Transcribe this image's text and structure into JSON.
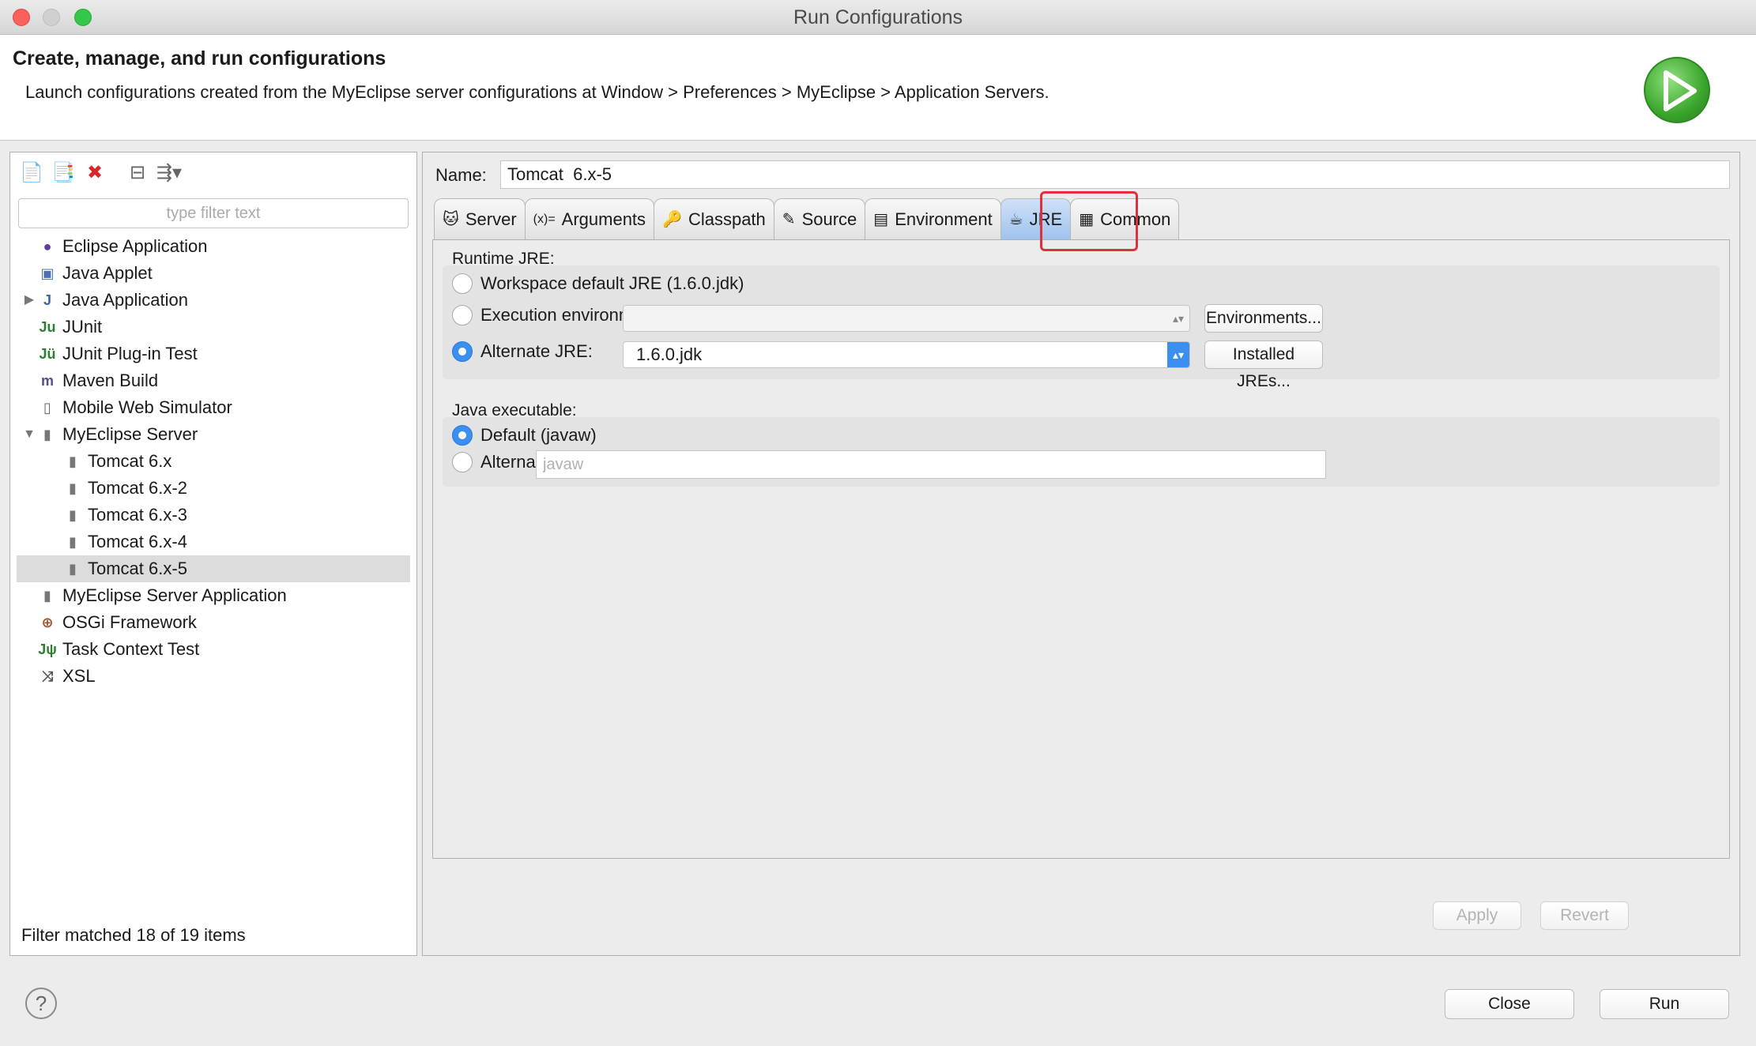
{
  "window": {
    "title": "Run Configurations"
  },
  "banner": {
    "title": "Create, manage, and run configurations",
    "description": "Launch configurations created from the MyEclipse server configurations at Window > Preferences > MyEclipse > Application Servers.",
    "icon": "run-icon"
  },
  "left": {
    "toolbar": [
      {
        "name": "new-config-icon",
        "glyph": "📄"
      },
      {
        "name": "duplicate-config-icon",
        "glyph": "📑"
      },
      {
        "name": "delete-config-icon",
        "glyph": "✖"
      },
      {
        "name": "collapse-all-icon",
        "glyph": "⊟"
      },
      {
        "name": "filter-menu-icon",
        "glyph": "⇶▾"
      }
    ],
    "filter_placeholder": "type filter text",
    "tree": [
      {
        "label": "Eclipse Application",
        "icon": "eclipse-icon",
        "glyph": "●",
        "color": "#5a3d9e",
        "level": 0
      },
      {
        "label": "Java Applet",
        "icon": "applet-icon",
        "glyph": "▣",
        "color": "#4a6fb5",
        "level": 0
      },
      {
        "label": "Java Application",
        "icon": "java-app-icon",
        "glyph": "J",
        "color": "#3b63a8",
        "level": 0,
        "expander": "▶"
      },
      {
        "label": "JUnit",
        "icon": "junit-icon",
        "glyph": "Ju",
        "color": "#2f7d32",
        "level": 0
      },
      {
        "label": "JUnit Plug-in Test",
        "icon": "junit-plugin-icon",
        "glyph": "Jü",
        "color": "#2f7d32",
        "level": 0
      },
      {
        "label": "Maven Build",
        "icon": "maven-icon",
        "glyph": "m",
        "color": "#5a4a8e",
        "level": 0
      },
      {
        "label": "Mobile Web Simulator",
        "icon": "mobile-sim-icon",
        "glyph": "▯",
        "color": "#666666",
        "level": 0
      },
      {
        "label": "MyEclipse Server",
        "icon": "server-icon",
        "glyph": "▮",
        "color": "#777777",
        "level": 0,
        "expander": "▼"
      },
      {
        "label": "Tomcat  6.x",
        "icon": "server-config-icon",
        "glyph": "▮",
        "color": "#777777",
        "level": 1
      },
      {
        "label": "Tomcat  6.x-2",
        "icon": "server-config-icon",
        "glyph": "▮",
        "color": "#777777",
        "level": 1
      },
      {
        "label": "Tomcat  6.x-3",
        "icon": "server-config-icon",
        "glyph": "▮",
        "color": "#777777",
        "level": 1
      },
      {
        "label": "Tomcat  6.x-4",
        "icon": "server-config-icon",
        "glyph": "▮",
        "color": "#777777",
        "level": 1
      },
      {
        "label": "Tomcat  6.x-5",
        "icon": "server-config-icon",
        "glyph": "▮",
        "color": "#777777",
        "level": 1,
        "selected": true
      },
      {
        "label": "MyEclipse Server Application",
        "icon": "server-app-icon",
        "glyph": "▮",
        "color": "#777777",
        "level": 0
      },
      {
        "label": "OSGi Framework",
        "icon": "osgi-icon",
        "glyph": "⊕",
        "color": "#a0522d",
        "level": 0
      },
      {
        "label": "Task Context Test",
        "icon": "task-test-icon",
        "glyph": "Jψ",
        "color": "#2f7d32",
        "level": 0
      },
      {
        "label": "XSL",
        "icon": "xsl-icon",
        "glyph": "⤨",
        "color": "#555555",
        "level": 0
      }
    ],
    "status": "Filter matched 18 of 19 items"
  },
  "right": {
    "name_label": "Name:",
    "name_value": "Tomcat  6.x-5",
    "tabs": [
      {
        "label": "Server",
        "icon": "server-tab-icon",
        "glyph": "🐱"
      },
      {
        "label": "Arguments",
        "icon": "arguments-tab-icon",
        "glyph": "(x)="
      },
      {
        "label": "Classpath",
        "icon": "classpath-tab-icon",
        "glyph": "🔑"
      },
      {
        "label": "Source",
        "icon": "source-tab-icon",
        "glyph": "✎"
      },
      {
        "label": "Environment",
        "icon": "environment-tab-icon",
        "glyph": "▤"
      },
      {
        "label": "JRE",
        "icon": "jre-tab-icon",
        "glyph": "☕",
        "active": true
      },
      {
        "label": "Common",
        "icon": "common-tab-icon",
        "glyph": "▦"
      }
    ],
    "runtime_jre": {
      "label": "Runtime JRE:",
      "workspace_default": "Workspace default JRE (1.6.0.jdk)",
      "execution_env": "Execution environment:",
      "environments_button": "Environments...",
      "alternate_jre": "Alternate JRE:",
      "alternate_value": "1.6.0.jdk",
      "installed_button": "Installed JREs...",
      "selected": "alternate"
    },
    "java_exec": {
      "label": "Java executable:",
      "default": "Default (javaw)",
      "alternate": "Alternate",
      "alternate_placeholder": "javaw",
      "selected": "default"
    },
    "apply": "Apply",
    "revert": "Revert"
  },
  "footer": {
    "help": "?",
    "close": "Close",
    "run": "Run"
  },
  "colors": {
    "accent": "#3b8ff0",
    "highlight": "#e0303a",
    "run_green": "#3aa52b"
  }
}
